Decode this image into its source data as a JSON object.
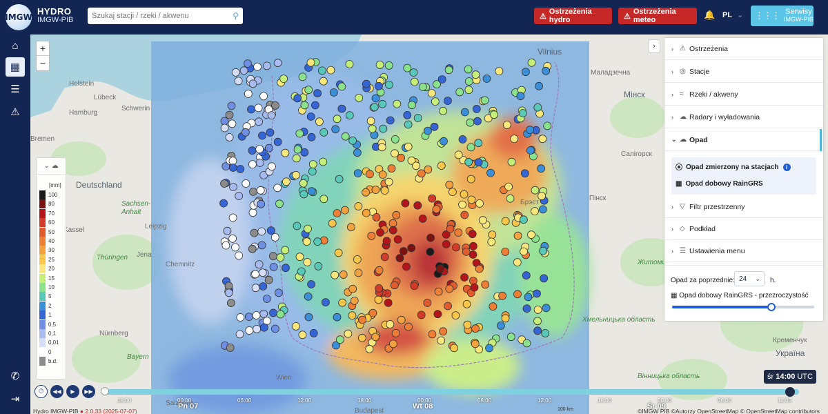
{
  "header": {
    "logo_text": "IMGW",
    "brand_line1": "HYDRO",
    "brand_line2": "IMGW-PIB",
    "search_placeholder": "Szukaj stacji / rzeki / akwenu",
    "warn_hydro": "Ostrzeżenia hydro",
    "warn_meteo": "Ostrzeżenia meteo",
    "lang": "PL",
    "services_line1": "Serwisy",
    "services_line2": "IMGW-PIB"
  },
  "rail": {
    "icons": [
      "home-icon",
      "map-icon",
      "list-icon",
      "warning-icon",
      "phone-icon",
      "logout-icon"
    ]
  },
  "map": {
    "labels": {
      "vilnius": "Vilnius",
      "hamburg": "Hamburg",
      "schwerin": "Schwerin",
      "lubeck": "Lübeck",
      "holstein": "Holstein",
      "bremen": "Bremen",
      "deutschland": "Deutschland",
      "sachsen": "Sachsen-",
      "anhalt": "Anhalt",
      "leipzig": "Leipzig",
      "kassel": "Kassel",
      "jena": "Jena",
      "chemnitz": "Chemnitz",
      "thuringen": "Thüringen",
      "nurnberg": "Nürnberg",
      "bayern": "Bayern",
      "wien": "Wien",
      "salzburg": "Salzburg",
      "budapest": "Budapest",
      "minsk": "Мінск",
      "malad": "Маладзечна",
      "salihorsk": "Салігорск",
      "brest": "Брэст",
      "pinsk": "Пінск",
      "zhytomyr": "Житомирська область",
      "khmelnytskyi": "Хмельницька область",
      "ukraina": "Україна",
      "kremenchuk": "Кременчук",
      "vinnytsia": "Вінницька область"
    }
  },
  "legend": {
    "unit": "[mm]",
    "steps": [
      {
        "label": "100",
        "color": "#1a1a1a"
      },
      {
        "label": "80",
        "color": "#7b1212"
      },
      {
        "label": "70",
        "color": "#b3151a"
      },
      {
        "label": "60",
        "color": "#d23a2a"
      },
      {
        "label": "50",
        "color": "#e25b2f"
      },
      {
        "label": "40",
        "color": "#ee7d36"
      },
      {
        "label": "30",
        "color": "#f4a23f"
      },
      {
        "label": "25",
        "color": "#f7c64b"
      },
      {
        "label": "20",
        "color": "#fbe77b"
      },
      {
        "label": "15",
        "color": "#c6ef7a"
      },
      {
        "label": "10",
        "color": "#8be28c"
      },
      {
        "label": "5",
        "color": "#58c9b8"
      },
      {
        "label": "2",
        "color": "#3a8fd8"
      },
      {
        "label": "1",
        "color": "#3665d6"
      },
      {
        "label": "0,5",
        "color": "#6f8fe4"
      },
      {
        "label": "0,1",
        "color": "#a8bbf0"
      },
      {
        "label": "0,01",
        "color": "#d6def7"
      },
      {
        "label": "0",
        "color": "#ffffff"
      },
      {
        "label": "b.d.",
        "color": "#8c8c8c"
      }
    ]
  },
  "panel": {
    "items": [
      {
        "label": "Ostrzeżenia",
        "icon": "warning-icon"
      },
      {
        "label": "Stacje",
        "icon": "station-icon"
      },
      {
        "label": "Rzeki / akweny",
        "icon": "river-icon"
      },
      {
        "label": "Radary i wyładowania",
        "icon": "radar-icon"
      },
      {
        "label": "Opad",
        "icon": "rain-icon"
      },
      {
        "label": "Filtr przestrzenny",
        "icon": "filter-icon"
      },
      {
        "label": "Podkład",
        "icon": "layers-icon"
      },
      {
        "label": "Ustawienia menu",
        "icon": "settings-icon"
      }
    ],
    "sub1": "Opad zmierzony na stacjach",
    "sub2": "Opad dobowy RainGRS",
    "period_label": "Opad za poprzednie:",
    "period_value": "24",
    "period_unit": "h.",
    "transparency_label": "Opad dobowy RainGRS - przezroczystość",
    "transparency_value": 0.7
  },
  "timeline": {
    "time_prefix": "śr",
    "time_value": "14:00",
    "time_suffix": "UTC",
    "ticks": [
      "18:00",
      "00:00",
      "06:00",
      "12:00",
      "18:00",
      "00:00",
      "06:00",
      "12:00",
      "18:00",
      "00:00",
      "06:00",
      "12:00"
    ],
    "days": [
      "Pn 07",
      "Wt 08",
      "Śr 09"
    ]
  },
  "footer": {
    "app": "Hydro IMGW-PIB",
    "version": "2.0.33 (2025-07-07)",
    "scale": "100 km",
    "attribution": "©IMGW PIB ©Autorzy OpenStreetMap © OpenStreetMap contributors"
  }
}
